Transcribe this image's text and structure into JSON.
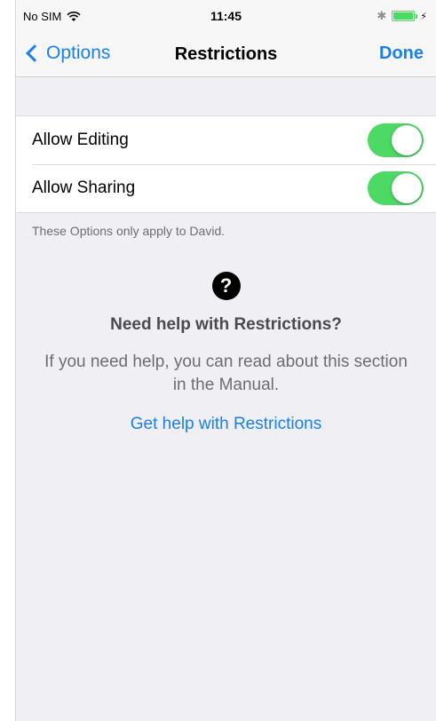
{
  "status_bar": {
    "carrier": "No SIM",
    "time": "11:45",
    "icons": [
      "wifi-icon",
      "bluetooth-icon",
      "battery-icon",
      "charging-icon"
    ]
  },
  "nav": {
    "back_label": "Options",
    "title": "Restrictions",
    "done_label": "Done"
  },
  "settings": [
    {
      "label": "Allow Editing",
      "enabled": true
    },
    {
      "label": "Allow Sharing",
      "enabled": true
    }
  ],
  "footnote": "These Options only apply to David.",
  "help": {
    "icon": "question-icon",
    "title": "Need help with Restrictions?",
    "body": "If you need help, you can read about this section in the Manual.",
    "link": "Get help with Restrictions"
  },
  "colors": {
    "accent": "#1a7ff0",
    "toggle_on": "#4cd964",
    "background": "#efeff4"
  }
}
